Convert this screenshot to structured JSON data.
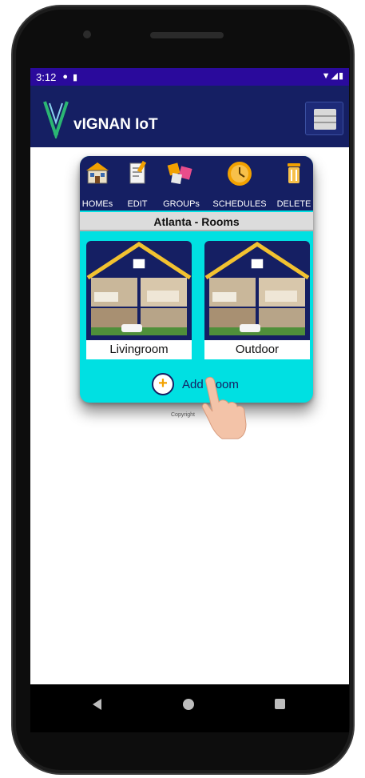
{
  "status_bar": {
    "time": "3:12"
  },
  "app": {
    "title": "vIGNAN IoT"
  },
  "toolbar": {
    "items": [
      {
        "label": "HOMEs",
        "icon": "house-icon"
      },
      {
        "label": "EDIT",
        "icon": "edit-icon"
      },
      {
        "label": "GROUPs",
        "icon": "puzzle-icon"
      },
      {
        "label": "SCHEDULES",
        "icon": "clock-icon"
      },
      {
        "label": "DELETE",
        "icon": "trash-icon"
      }
    ]
  },
  "rooms_header": "Atlanta - Rooms",
  "rooms": [
    {
      "name": "Livingroom"
    },
    {
      "name": "Outdoor"
    }
  ],
  "add_room": {
    "label": "Add Room"
  },
  "footer": {
    "copyright": "Copyright"
  },
  "colors": {
    "status_bar": "#2a0a9c",
    "app_bar": "#151f63",
    "panel_bg": "#00e0e2",
    "accent": "#f2a100"
  }
}
